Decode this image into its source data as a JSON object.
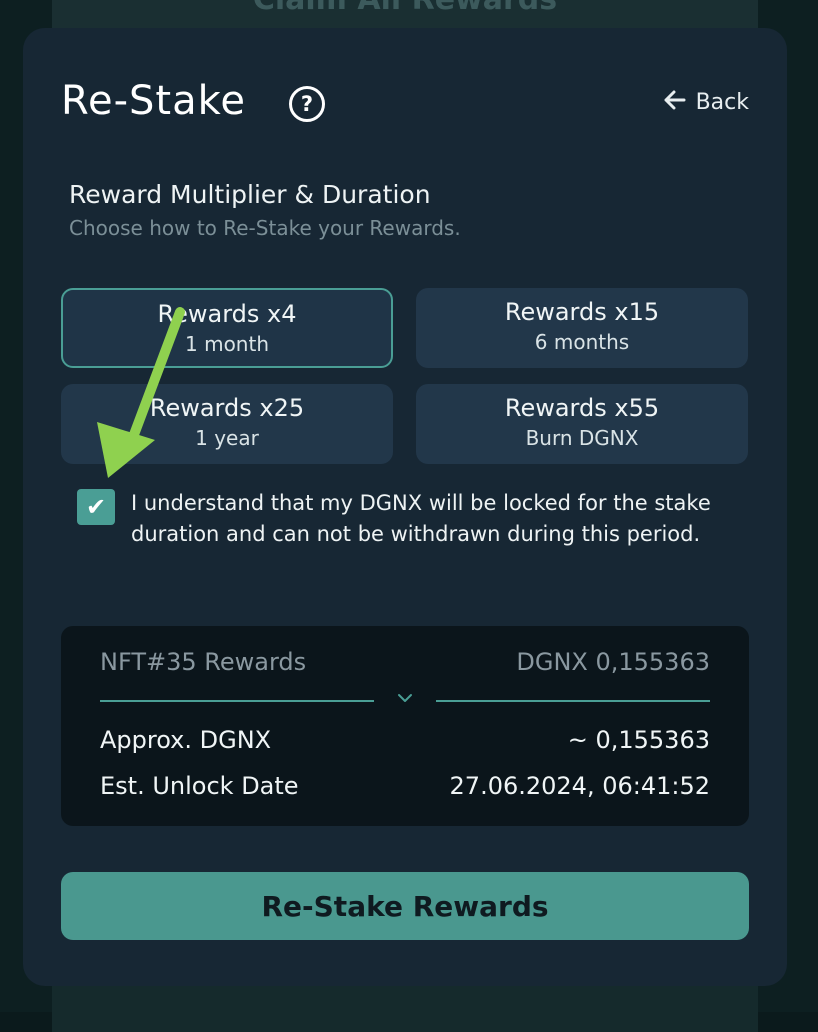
{
  "background": {
    "under_card_title": "Claim All Rewards"
  },
  "modal": {
    "title": "Re-Stake",
    "help_icon_glyph": "?",
    "back_icon": "arrow-left-icon",
    "back_label": "Back",
    "section_title": "Reward Multiplier & Duration",
    "section_subtitle": "Choose how to Re-Stake your Rewards.",
    "options": [
      {
        "label": "Rewards x4",
        "sub": "1 month",
        "selected": true
      },
      {
        "label": "Rewards x15",
        "sub": "6 months",
        "selected": false
      },
      {
        "label": "Rewards x25",
        "sub": "1 year",
        "selected": false
      },
      {
        "label": "Rewards x55",
        "sub": "Burn DGNX",
        "selected": false
      }
    ],
    "acknowledge": {
      "checked": true,
      "check_glyph": "✔",
      "text": "I understand that my DGNX will be locked for the stake duration and can not be withdrawn during this period."
    },
    "summary": {
      "rewards_label": "NFT#35 Rewards",
      "rewards_value": "DGNX 0,155363",
      "approx_label": "Approx. DGNX",
      "approx_value": "~ 0,155363",
      "unlock_label": "Est. Unlock Date",
      "unlock_value": "27.06.2024, 06:41:52"
    },
    "submit_label": "Re-Stake Rewards"
  },
  "colors": {
    "accent": "#4a9e95",
    "modal_bg": "#172734",
    "option_bg": "#22374a",
    "annotation_arrow": "#8fd14f"
  }
}
